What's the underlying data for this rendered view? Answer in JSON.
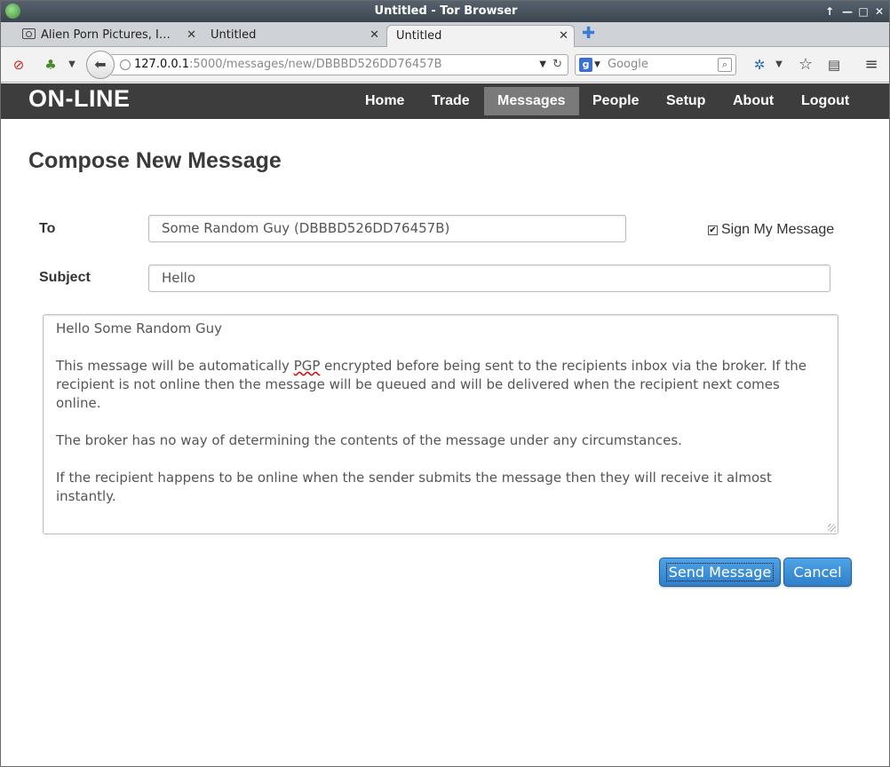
{
  "window": {
    "title": "Untitled - Tor Browser",
    "controls": [
      "↑",
      "—",
      "□",
      "✕"
    ]
  },
  "tabs": [
    {
      "label": "Alien Porn Pictures, I…",
      "icon": "camera-icon",
      "close": "✕"
    },
    {
      "label": "Untitled",
      "close": "✕"
    },
    {
      "label": "Untitled",
      "close": "✕",
      "active": true
    }
  ],
  "new_tab": "✚",
  "toolbar": {
    "url_host": "127.0.0.1",
    "url_rest": ":5000/messages/new/DBBBD526DD76457B",
    "search_placeholder": "Google",
    "search_engine_letter": "g"
  },
  "site": {
    "brand": "ON-LINE",
    "nav": [
      "Home",
      "Trade",
      "Messages",
      "People",
      "Setup",
      "About",
      "Logout"
    ],
    "active_nav": "Messages"
  },
  "form": {
    "title": "Compose New Message",
    "to_label": "To",
    "to_value": "Some Random Guy (DBBBD526DD76457B)",
    "sign_label": "Sign My Message",
    "sign_checked": true,
    "subject_label": "Subject",
    "subject_value": "Hello",
    "body": {
      "greeting": "Hello Some Random Guy",
      "p1_before": "This message will be automatically ",
      "p1_pgp": "PGP",
      "p1_after": " encrypted before being sent to the recipients inbox via the broker. If the recipient is not online then the message will be queued and will be delivered when the recipient next comes online.",
      "p2": "The broker has no way of determining the contents of the message under any circumstances.",
      "p3": "If the recipient happens to be online when the sender submits the message then they will receive it almost instantly."
    },
    "send_label": "Send Message",
    "cancel_label": "Cancel"
  },
  "colors": {
    "header_bg": "#3d3d3d",
    "nav_active_bg": "#7a7a7a",
    "button_blue": "#2f7fc8"
  }
}
